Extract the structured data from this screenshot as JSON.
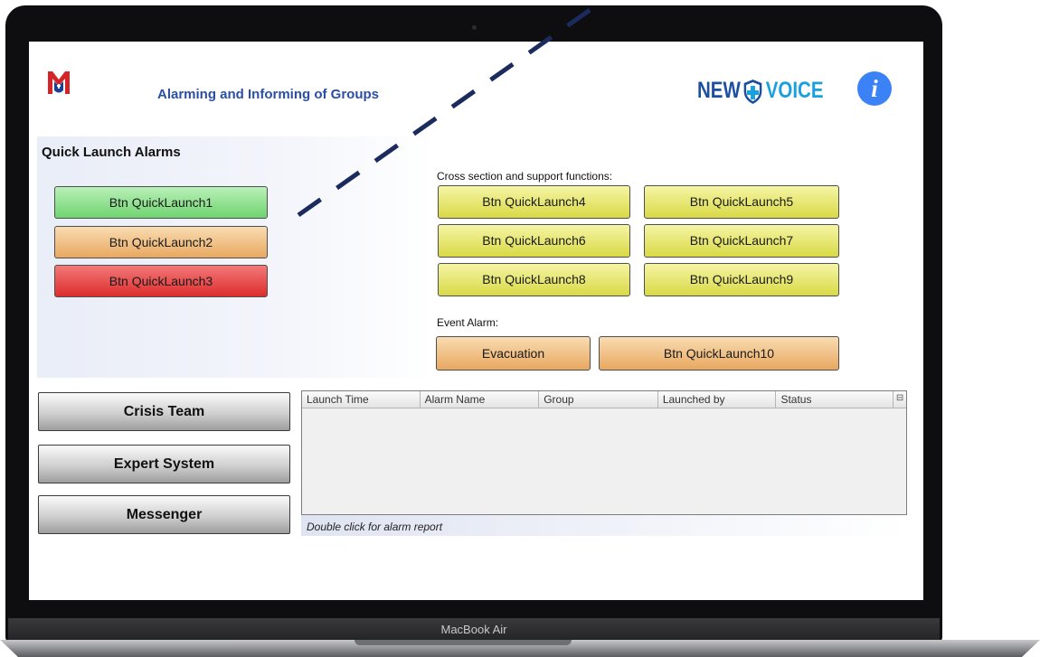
{
  "device": {
    "label": "MacBook Air"
  },
  "header": {
    "title": "Alarming and Informing of Groups",
    "brand_part1": "NEW",
    "brand_part2": "VOICE",
    "info_label": "i"
  },
  "quick_launch": {
    "title": "Quick Launch Alarms",
    "buttons": [
      "Btn QuickLaunch1",
      "Btn QuickLaunch2",
      "Btn QuickLaunch3"
    ]
  },
  "cross_section": {
    "label": "Cross section and support functions:",
    "buttons": [
      "Btn QuickLaunch4",
      "Btn QuickLaunch5",
      "Btn QuickLaunch6",
      "Btn QuickLaunch7",
      "Btn QuickLaunch8",
      "Btn QuickLaunch9"
    ]
  },
  "event_alarm": {
    "label": "Event Alarm:",
    "buttons": [
      "Evacuation",
      "Btn QuickLaunch10"
    ]
  },
  "nav_buttons": [
    "Crisis Team",
    "Expert System",
    "Messenger"
  ],
  "alarm_table": {
    "columns": [
      "Launch Time",
      "Alarm Name",
      "Group",
      "Launched by",
      "Status"
    ],
    "rows": [],
    "footer": "Double click for alarm report"
  },
  "colors": {
    "green": "#6fd46f",
    "orange": "#e8a860",
    "red": "#dd2d2d",
    "yellow": "#d9d946",
    "title_blue": "#2b4ea6",
    "info_blue": "#3b82f6"
  }
}
